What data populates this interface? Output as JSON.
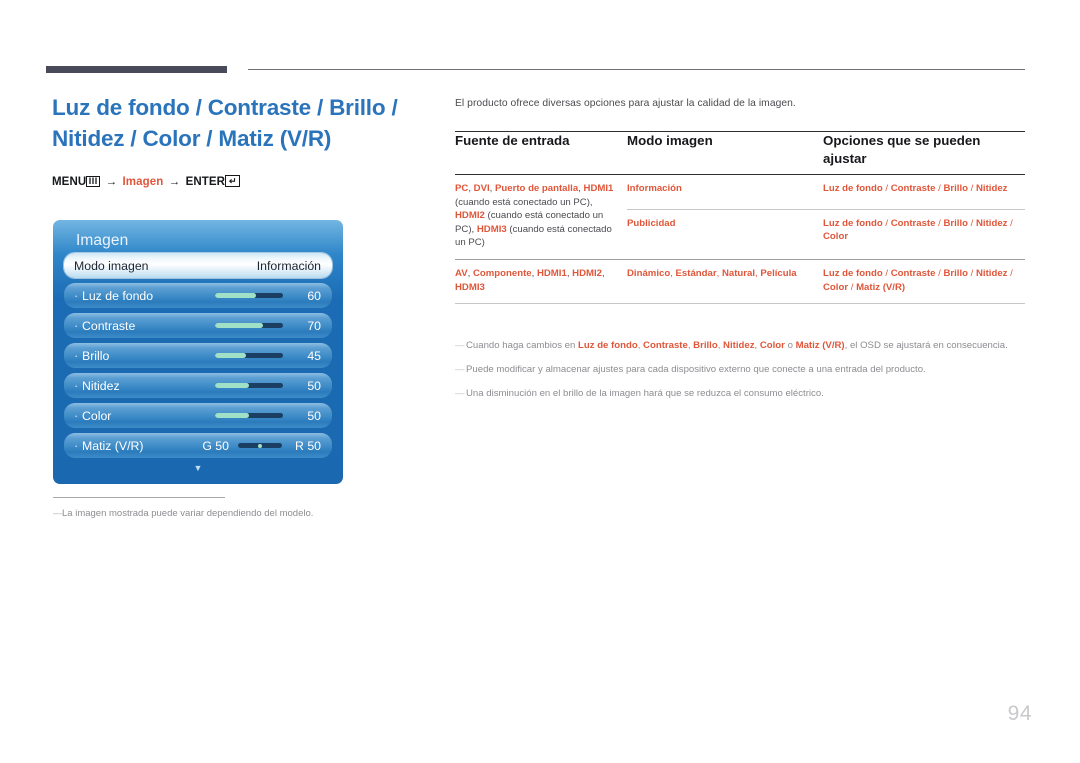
{
  "page_number": "94",
  "header": {
    "title": "Luz de fondo / Contraste / Brillo / Nitidez / Color / Matiz (V/R)",
    "menu_path": {
      "menu_label": "MENU",
      "menu_icon": "III",
      "arrow": "→",
      "target": "Imagen",
      "enter_label": "ENTER",
      "enter_icon": "↵"
    }
  },
  "osd": {
    "title": "Imagen",
    "rows": [
      {
        "label": "Modo imagen",
        "type": "value",
        "value": "Información",
        "active": true
      },
      {
        "label": "Luz de fondo",
        "type": "slider",
        "value": "60",
        "percent": 60,
        "active": false
      },
      {
        "label": "Contraste",
        "type": "slider",
        "value": "70",
        "percent": 70,
        "active": false
      },
      {
        "label": "Brillo",
        "type": "slider",
        "value": "45",
        "percent": 45,
        "active": false
      },
      {
        "label": "Nitidez",
        "type": "slider",
        "value": "50",
        "percent": 50,
        "active": false
      },
      {
        "label": "Color",
        "type": "slider",
        "value": "50",
        "percent": 50,
        "active": false
      },
      {
        "label": "Matiz (V/R)",
        "type": "dual",
        "left_value": "G 50",
        "right_value": "R 50",
        "active": false
      }
    ],
    "scroll_caret": "▼"
  },
  "left_note": "La imagen mostrada puede variar dependiendo del modelo.",
  "main": {
    "intro": "El producto ofrece diversas opciones para ajustar la calidad de la imagen.",
    "table": {
      "headers": [
        "Fuente de entrada",
        "Modo imagen",
        "Opciones que se pueden ajustar"
      ],
      "rows": [
        {
          "source_parts": [
            {
              "t": "PC",
              "o": true
            },
            {
              "t": ", ",
              "o": false
            },
            {
              "t": "DVI",
              "o": true
            },
            {
              "t": ", ",
              "o": false
            },
            {
              "t": "Puerto de pantalla",
              "o": true
            },
            {
              "t": ", ",
              "o": false
            },
            {
              "t": "HDMI1",
              "o": true
            },
            {
              "t": " (cuando está conectado un PC), ",
              "o": false
            },
            {
              "t": "HDMI2",
              "o": true
            },
            {
              "t": " (cuando está conectado un PC), ",
              "o": false
            },
            {
              "t": "HDMI3",
              "o": true
            },
            {
              "t": " (cuando está conectado un PC)",
              "o": false
            }
          ],
          "modes": [
            {
              "mode": "Información",
              "options": "Luz de fondo / Contraste / Brillo / Nitidez"
            },
            {
              "mode": "Publicidad",
              "options": "Luz de fondo / Contraste / Brillo / Nitidez / Color"
            }
          ]
        },
        {
          "source_parts": [
            {
              "t": "AV",
              "o": true
            },
            {
              "t": ", ",
              "o": false
            },
            {
              "t": "Componente",
              "o": true
            },
            {
              "t": ", ",
              "o": false
            },
            {
              "t": "HDMI1",
              "o": true
            },
            {
              "t": ", ",
              "o": false
            },
            {
              "t": "HDMI2",
              "o": true
            },
            {
              "t": ", ",
              "o": false
            },
            {
              "t": "HDMI3",
              "o": true
            }
          ],
          "modes": [
            {
              "mode": "Dinámico, Estándar, Natural, Película",
              "options": "Luz de fondo / Contraste / Brillo / Nitidez / Color / Matiz (V/R)"
            }
          ]
        }
      ]
    },
    "notes": [
      {
        "parts": [
          {
            "t": "Cuando haga cambios en ",
            "b": false
          },
          {
            "t": "Luz de fondo",
            "b": true
          },
          {
            "t": ", ",
            "b": false
          },
          {
            "t": "Contraste",
            "b": true
          },
          {
            "t": ", ",
            "b": false
          },
          {
            "t": "Brillo",
            "b": true
          },
          {
            "t": ", ",
            "b": false
          },
          {
            "t": "Nitidez",
            "b": true
          },
          {
            "t": ", ",
            "b": false
          },
          {
            "t": "Color",
            "b": true
          },
          {
            "t": " o ",
            "b": false
          },
          {
            "t": "Matiz (V/R)",
            "b": true
          },
          {
            "t": ", el OSD se ajustará en consecuencia.",
            "b": false
          }
        ]
      },
      {
        "parts": [
          {
            "t": "Puede modificar y almacenar ajustes para cada dispositivo externo que conecte a una entrada del producto.",
            "b": false
          }
        ]
      },
      {
        "parts": [
          {
            "t": "Una disminución en el brillo de la imagen hará que se reduzca el consumo eléctrico.",
            "b": false
          }
        ]
      }
    ]
  },
  "colors": {
    "title_blue": "#2a74bb",
    "accent_orange": "#e0563a",
    "rule_dark": "#494a5a",
    "osd_blue": "#1a68b0",
    "slider_fill": "#9fe0c6"
  }
}
